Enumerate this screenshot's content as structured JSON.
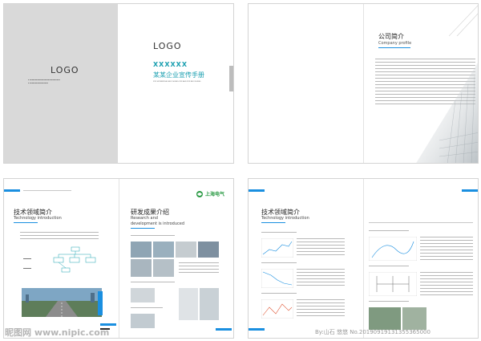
{
  "cover": {
    "logo_left": "LOGO",
    "logo_right": "LOGO",
    "code": "XXXXXX",
    "title_cn": "某某企业宣传手册",
    "title_en": "XXX ENTERPRISES BROCHURES XXX AND XXX BROCHURES",
    "accent_color": "#1a9fb0"
  },
  "company": {
    "title_cn": "公司简介",
    "title_en": "Company profile"
  },
  "tech1": {
    "title_cn": "技术领域简介",
    "title_en": "Technology introduction"
  },
  "research": {
    "title_cn": "研发成果介绍",
    "title_en_1": "Research and",
    "title_en_2": "development is introduced",
    "brand": "上海电气"
  },
  "tech2": {
    "title_cn": "技术领域简介",
    "title_en": "Technology introduction"
  },
  "watermark": {
    "left": "昵图网 www.nipic.com",
    "right": "By:山石 悠悠 No.20190919131355365000"
  },
  "colors": {
    "blue": "#1a8fe0",
    "gray_panel": "#d9d9d9",
    "teal": "#1a9fb0"
  }
}
